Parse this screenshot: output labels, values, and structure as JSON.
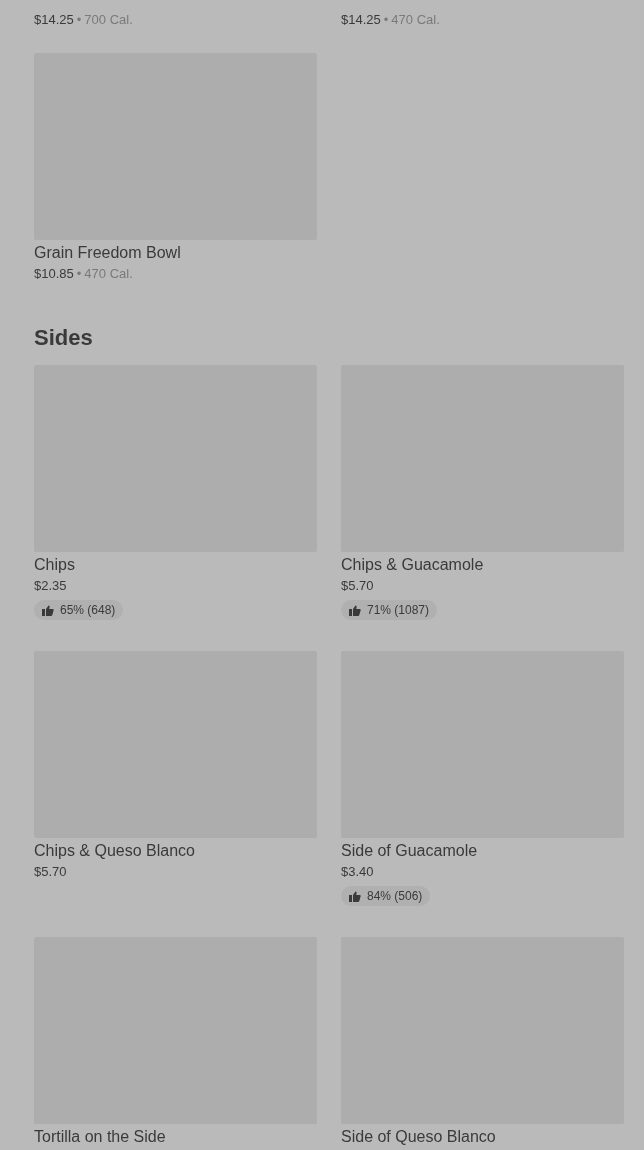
{
  "sections": [
    {
      "partial_items": [
        {
          "price": "$14.25",
          "separator": "•",
          "calories": "700 Cal."
        },
        {
          "price": "$14.25",
          "separator": "•",
          "calories": "470 Cal."
        }
      ],
      "items": [
        {
          "name": "Grain Freedom Bowl",
          "price": "$10.85",
          "separator": "•",
          "calories": "470 Cal."
        }
      ]
    },
    {
      "title": "Sides",
      "items": [
        {
          "name": "Chips",
          "price": "$2.35",
          "rating": "65% (648)"
        },
        {
          "name": "Chips & Guacamole",
          "price": "$5.70",
          "rating": "71% (1087)"
        },
        {
          "name": "Chips & Queso Blanco",
          "price": "$5.70"
        },
        {
          "name": "Side of Guacamole",
          "price": "$3.40",
          "rating": "84% (506)"
        },
        {
          "name": "Tortilla on the Side"
        },
        {
          "name": "Side of Queso Blanco"
        }
      ]
    }
  ]
}
